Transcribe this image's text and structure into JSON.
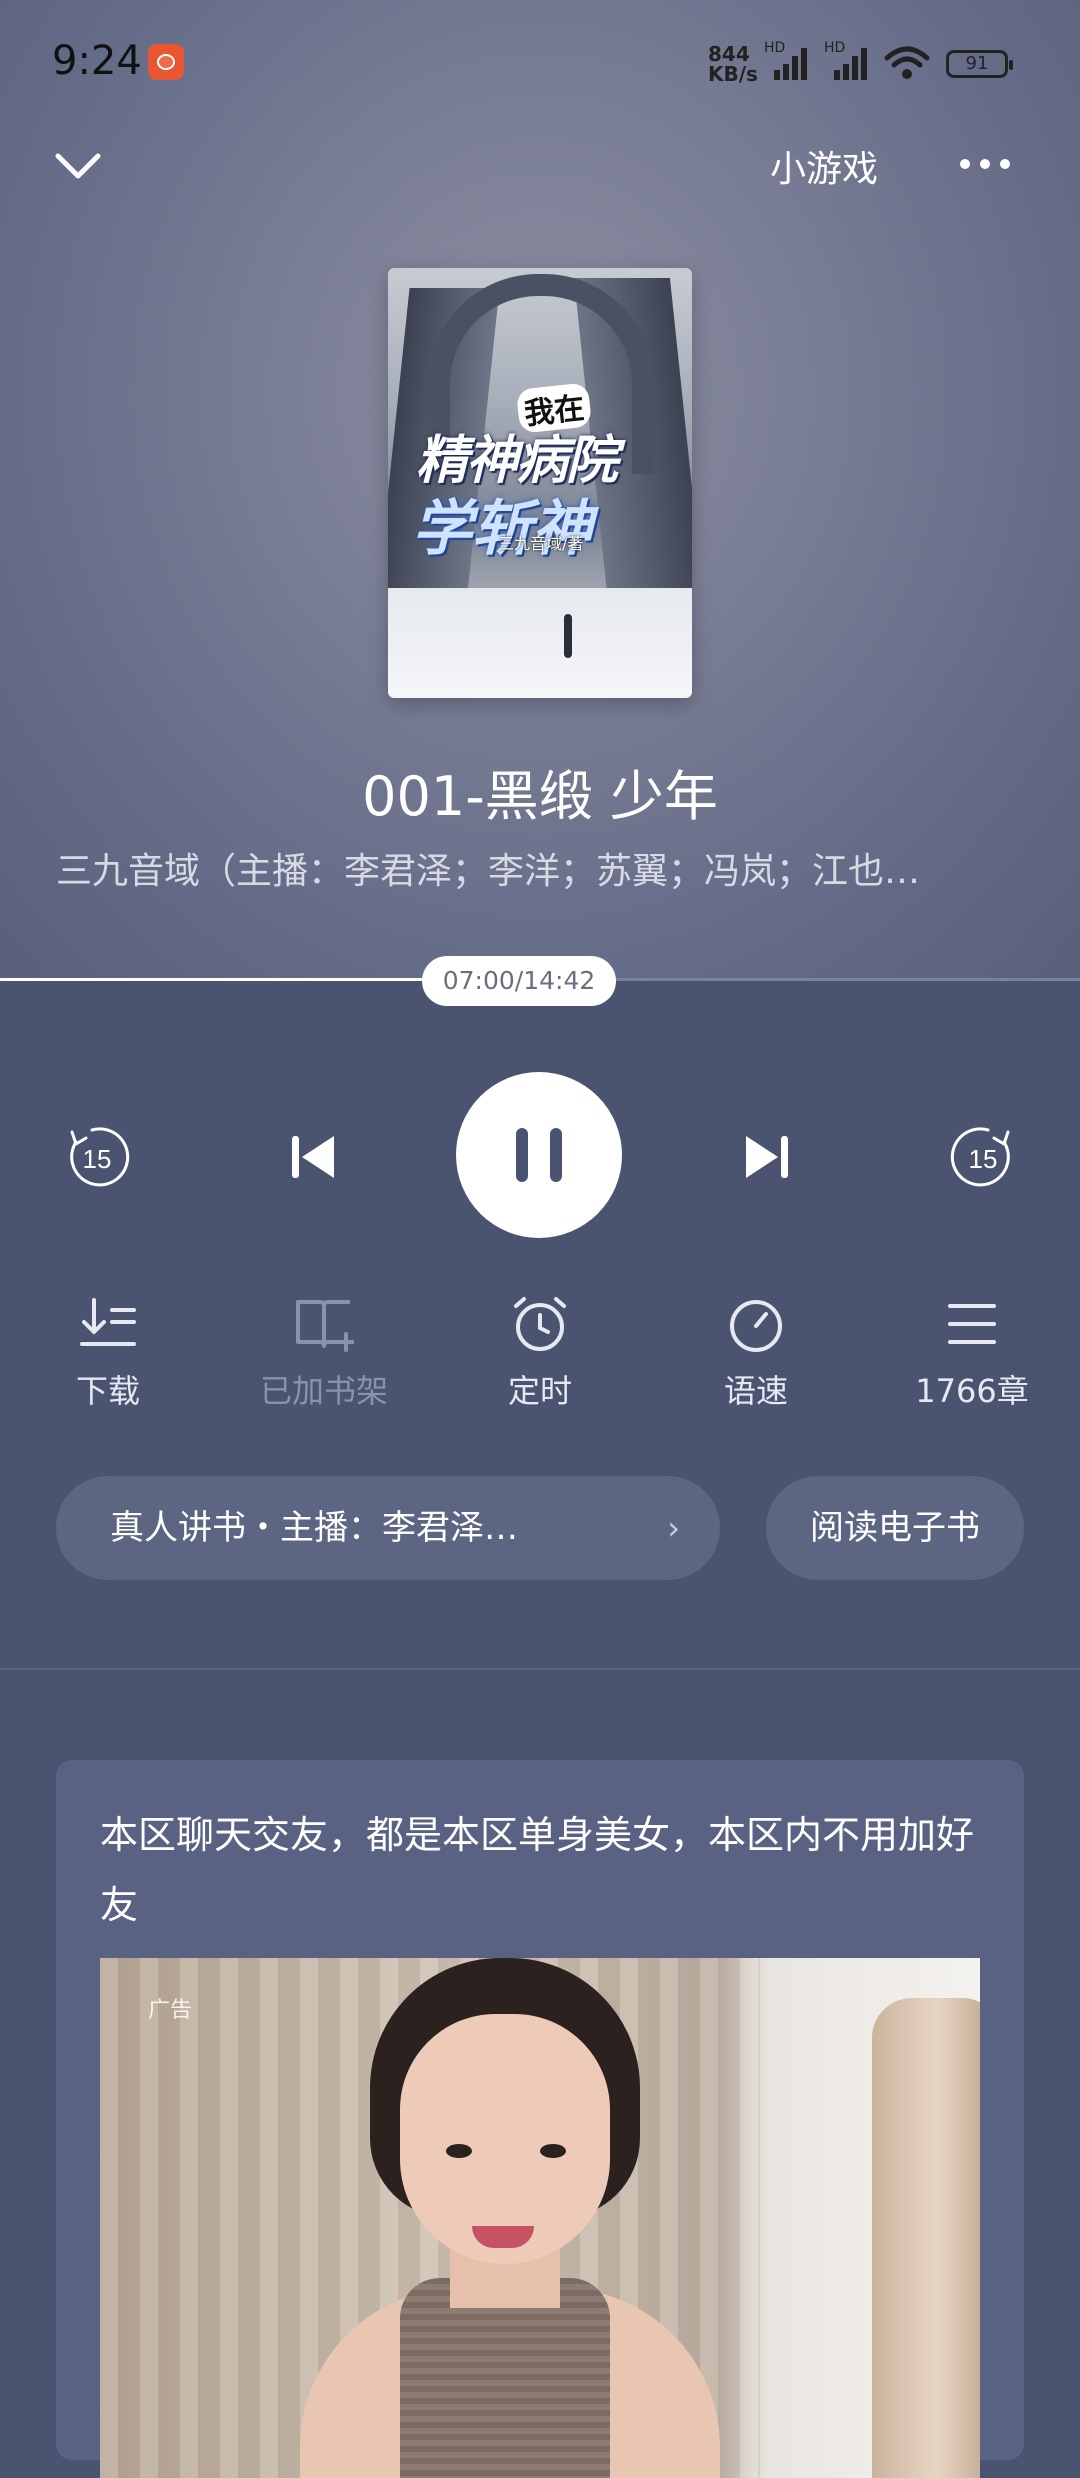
{
  "status_bar": {
    "time": "9:24",
    "net_speed_value": "844",
    "net_speed_unit": "KB/s",
    "sim1_label": "HD",
    "sim2_label": "HD",
    "battery": "91"
  },
  "nav": {
    "mini_games": "小游戏"
  },
  "cover": {
    "line1": "我在",
    "line2": "精神病院",
    "line3": "学斩神",
    "author": "三九音域/著"
  },
  "track": {
    "title": "001-黑缎 少年",
    "subtitle": "三九音域（主播：李君泽；李洋；苏翼；冯岚；江也…"
  },
  "progress": {
    "label": "07:00/14:42",
    "fraction": 0.476
  },
  "controls": {
    "rewind_seconds": "15",
    "forward_seconds": "15"
  },
  "actions": [
    {
      "label": "下载",
      "icon": "download-icon"
    },
    {
      "label": "已加书架",
      "icon": "bookshelf-added-icon"
    },
    {
      "label": "定时",
      "icon": "alarm-clock-icon"
    },
    {
      "label": "语速",
      "icon": "speed-gauge-icon"
    },
    {
      "label": "1766章",
      "icon": "chapter-list-icon"
    }
  ],
  "narrator_pill": "真人讲书・主播：李君泽…",
  "read_ebook": "阅读电子书",
  "ad": {
    "text": "本区聊天交友，都是本区单身美女，本区内不用加好友",
    "label": "广告"
  },
  "colors": {
    "background": "#4a5471",
    "card": "#596282",
    "pill": "#5c6582"
  }
}
